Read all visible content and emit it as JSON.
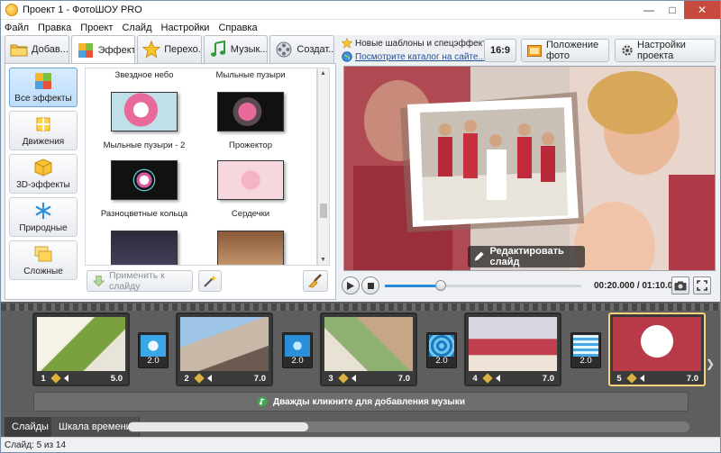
{
  "window": {
    "title": "Проект 1 - ФотоШОУ PRO"
  },
  "menu": [
    "Файл",
    "Правка",
    "Проект",
    "Слайд",
    "Настройки",
    "Справка"
  ],
  "tabs": [
    {
      "label": "Добав...",
      "icon": "folder-icon"
    },
    {
      "label": "Эффект...",
      "icon": "puzzle-icon"
    },
    {
      "label": "Перехо...",
      "icon": "star-icon"
    },
    {
      "label": "Музык...",
      "icon": "music-icon"
    },
    {
      "label": "Создат...",
      "icon": "film-reel-icon"
    }
  ],
  "categories": [
    {
      "label": "Все эффекты",
      "icon": "puzzle-icon"
    },
    {
      "label": "Движения",
      "icon": "move-arrows-icon"
    },
    {
      "label": "3D-эффекты",
      "icon": "cube-icon"
    },
    {
      "label": "Природные",
      "icon": "snowflake-icon"
    },
    {
      "label": "Сложные",
      "icon": "layers-icon"
    }
  ],
  "effects": [
    "Звездное небо",
    "Мыльные пузыри",
    "Мыльные пузыри - 2",
    "Прожектор",
    "Разноцветные кольца",
    "Сердечки",
    "",
    ""
  ],
  "effects_panel": {
    "apply_label": "Применить к слайду"
  },
  "topbar": {
    "new_templates": "Новые шаблоны и спецэффекты",
    "catalog_link": "Посмотрите каталог на сайте...",
    "aspect_label": "16:9",
    "photo_position": "Положение фото",
    "project_settings": "Настройки проекта"
  },
  "preview": {
    "edit_label": "Редактировать слайд"
  },
  "player": {
    "timecode": "00:20.000 / 01:10.000",
    "progress": 0.285
  },
  "slides": [
    {
      "num": "1",
      "duration": "5.0"
    },
    {
      "num": "2",
      "duration": "7.0"
    },
    {
      "num": "3",
      "duration": "7.0"
    },
    {
      "num": "4",
      "duration": "7.0"
    },
    {
      "num": "5",
      "duration": "7.0"
    }
  ],
  "transitions": [
    "2.0",
    "2.0",
    "2.0",
    "2.0"
  ],
  "music": {
    "hint": "Дважды кликните для добавления музыки"
  },
  "bottom_tabs": [
    "Слайды",
    "Шкала времени"
  ],
  "status": {
    "text": "Слайд: 5 из 14"
  },
  "colors": {
    "accent": "#2a8bd8",
    "close_button": "#c74a3f",
    "selected_slide": "#f4d27a",
    "timeline_bg": "#5e5e5e"
  }
}
